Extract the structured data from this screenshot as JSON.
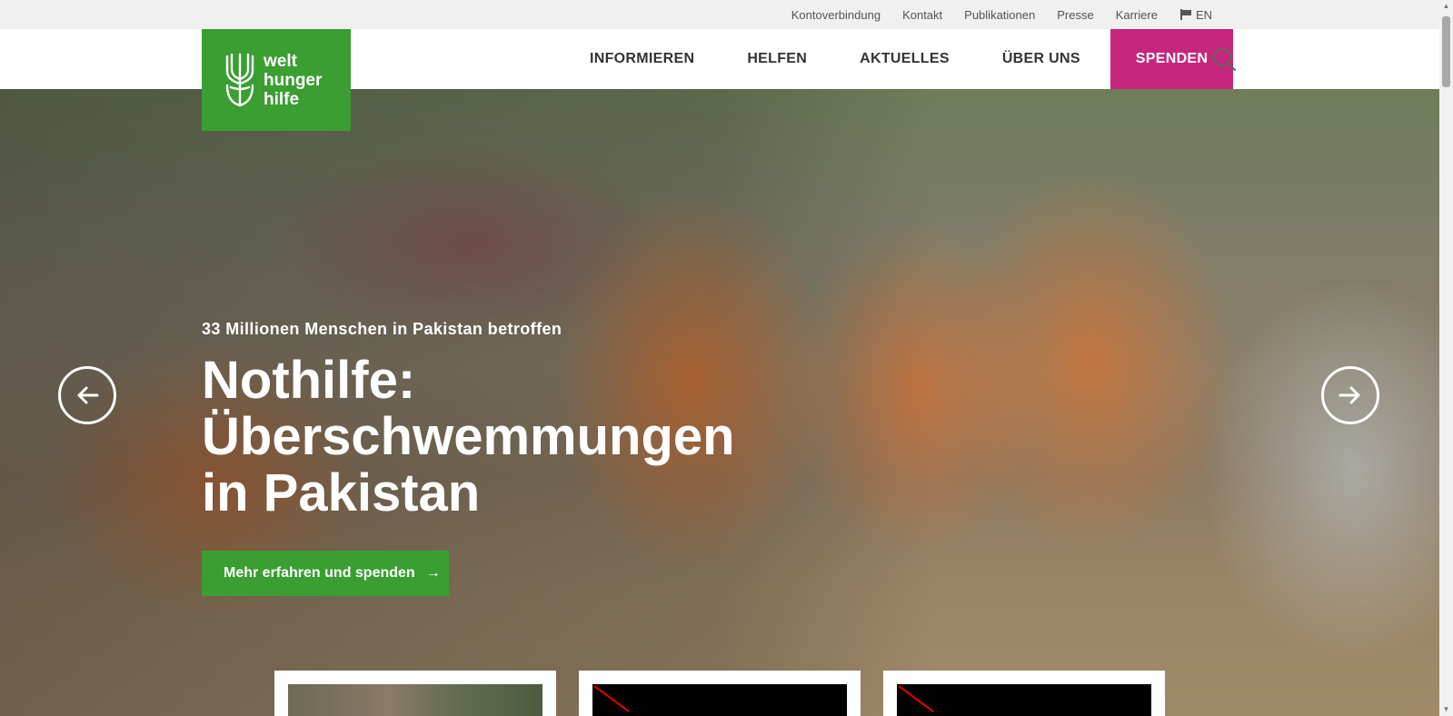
{
  "utility_bar": {
    "links": [
      "Kontoverbindung",
      "Kontakt",
      "Publikationen",
      "Presse",
      "Karriere"
    ],
    "language": "EN"
  },
  "logo": {
    "line1": "welt",
    "line2": "hunger",
    "line3": "hilfe",
    "color": "#3a9e32"
  },
  "nav": {
    "items": [
      "INFORMIEREN",
      "HELFEN",
      "AKTUELLES",
      "ÜBER UNS"
    ],
    "donate": "SPENDEN",
    "donate_color": "#c6267c"
  },
  "hero": {
    "subtitle": "33 Millionen Menschen in Pakistan betroffen",
    "title_line1": "Nothilfe:",
    "title_line2": "Überschwemmungen",
    "title_line3": "in Pakistan",
    "cta": "Mehr erfahren und spenden"
  },
  "icons": [
    "flag-icon",
    "search-icon",
    "arrow-left-icon",
    "arrow-right-icon",
    "broken-video-icon"
  ]
}
